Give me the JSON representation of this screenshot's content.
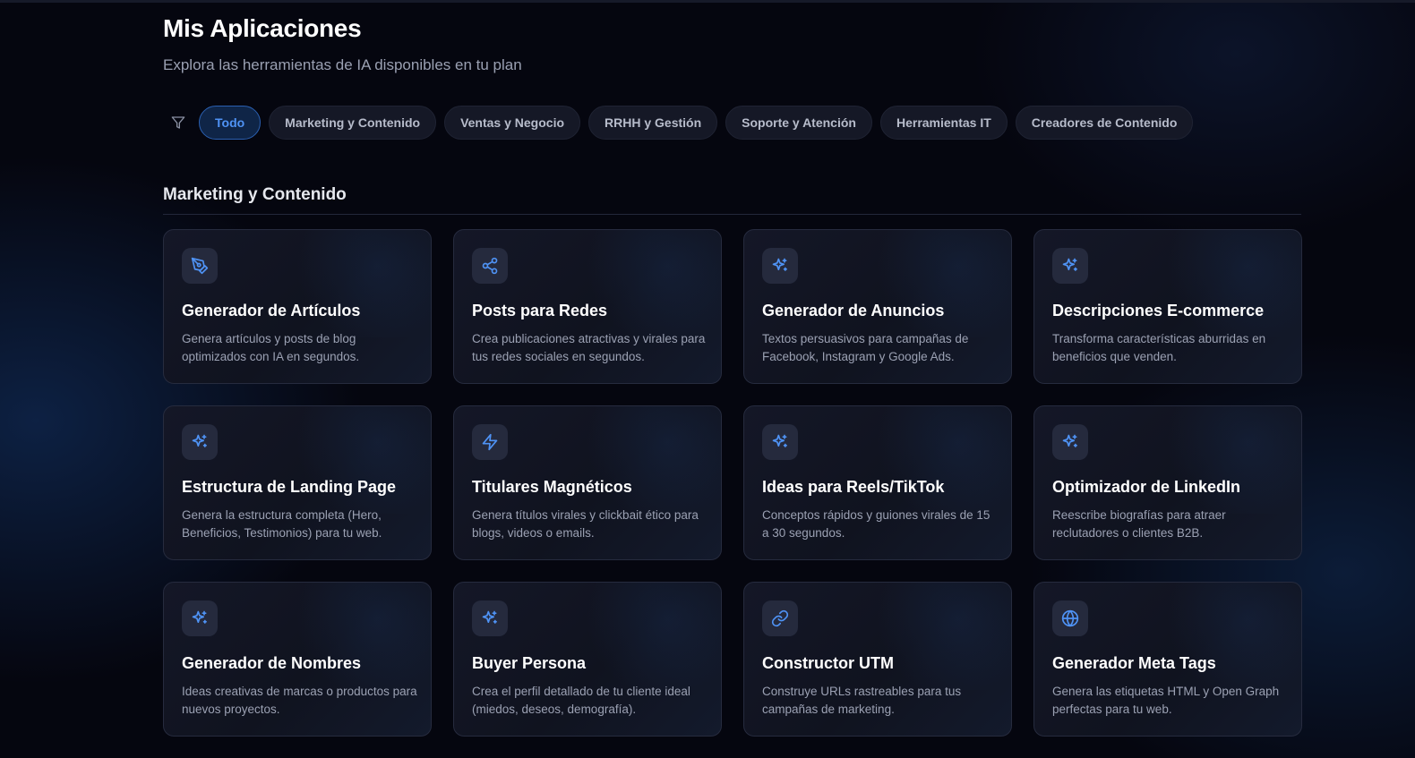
{
  "header": {
    "title": "Mis Aplicaciones",
    "subtitle": "Explora las herramientas de IA disponibles en tu plan"
  },
  "filters": {
    "icon": "filter-icon",
    "items": [
      {
        "label": "Todo",
        "active": true
      },
      {
        "label": "Marketing y Contenido",
        "active": false
      },
      {
        "label": "Ventas y Negocio",
        "active": false
      },
      {
        "label": "RRHH y Gestión",
        "active": false
      },
      {
        "label": "Soporte y Atención",
        "active": false
      },
      {
        "label": "Herramientas IT",
        "active": false
      },
      {
        "label": "Creadores de Contenido",
        "active": false
      }
    ]
  },
  "section": {
    "title": "Marketing y Contenido",
    "cards": [
      {
        "icon": "pen-tool-icon",
        "title": "Generador de Artículos",
        "description": "Genera artículos y posts de blog optimizados con IA en segundos."
      },
      {
        "icon": "share-icon",
        "title": "Posts para Redes",
        "description": "Crea publicaciones atractivas y virales para tus redes sociales en segundos."
      },
      {
        "icon": "sparkles-icon",
        "title": "Generador de Anuncios",
        "description": "Textos persuasivos para campañas de Facebook, Instagram y Google Ads."
      },
      {
        "icon": "sparkles-icon",
        "title": "Descripciones E-commerce",
        "description": "Transforma características aburridas en beneficios que venden."
      },
      {
        "icon": "sparkles-icon",
        "title": "Estructura de Landing Page",
        "description": "Genera la estructura completa (Hero, Beneficios, Testimonios) para tu web."
      },
      {
        "icon": "zap-icon",
        "title": "Titulares Magnéticos",
        "description": "Genera títulos virales y clickbait ético para blogs, videos o emails."
      },
      {
        "icon": "sparkles-icon",
        "title": "Ideas para Reels/TikTok",
        "description": "Conceptos rápidos y guiones virales de 15 a 30 segundos."
      },
      {
        "icon": "sparkles-icon",
        "title": "Optimizador de LinkedIn",
        "description": "Reescribe biografías para atraer reclutadores o clientes B2B."
      },
      {
        "icon": "sparkles-icon",
        "title": "Generador de Nombres",
        "description": "Ideas creativas de marcas o productos para nuevos proyectos."
      },
      {
        "icon": "sparkles-icon",
        "title": "Buyer Persona",
        "description": "Crea el perfil detallado de tu cliente ideal (miedos, deseos, demografía)."
      },
      {
        "icon": "link-icon",
        "title": "Constructor UTM",
        "description": "Construye URLs rastreables para tus campañas de marketing."
      },
      {
        "icon": "globe-icon",
        "title": "Generador Meta Tags",
        "description": "Genera las etiquetas HTML y Open Graph perfectas para tu web."
      }
    ]
  },
  "colors": {
    "background": "#05060f",
    "accent": "#4f93f5",
    "card": "#131627",
    "chip": "#151826"
  }
}
